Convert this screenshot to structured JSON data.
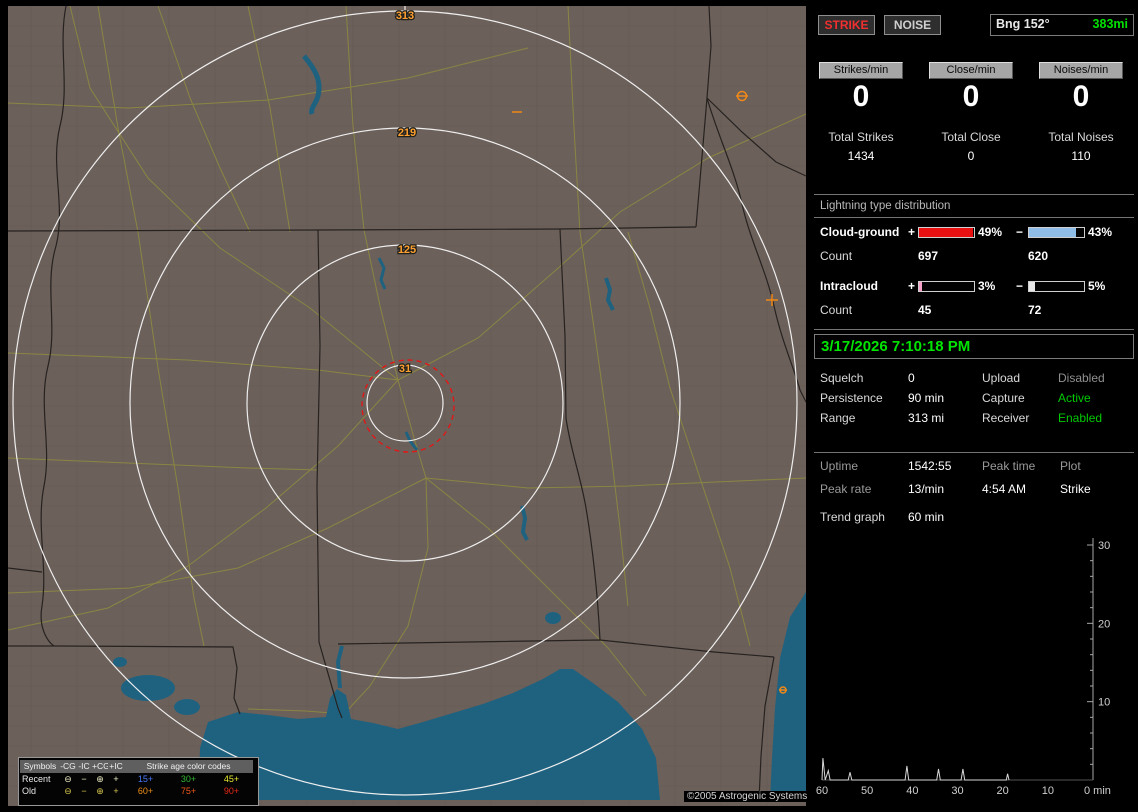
{
  "window": {
    "copyright": "©2005 Astrogenic Systems"
  },
  "map": {
    "range_labels": [
      "313",
      "219",
      "125",
      "31"
    ],
    "legend": {
      "symbols_header": "Symbols",
      "col_headers": [
        "-CG",
        "-IC",
        "+CG",
        "+IC"
      ],
      "age_header": "Strike age color codes",
      "rows": [
        {
          "label": "Recent",
          "symbols": [
            "⊖",
            "−",
            "⊕",
            "+"
          ],
          "symbol_color": "#f0f0c8",
          "ages": [
            "15+",
            "30+",
            "45+"
          ],
          "age_colors": [
            "#4878f8",
            "#30b830",
            "#e8e830"
          ]
        },
        {
          "label": "Old",
          "symbols": [
            "⊖",
            "−",
            "⊕",
            "+"
          ],
          "symbol_color": "#d8c850",
          "ages": [
            "60+",
            "75+",
            "90+"
          ],
          "age_colors": [
            "#f09018",
            "#f05818",
            "#e82818"
          ]
        }
      ]
    }
  },
  "sidebar": {
    "strike_button": "STRIKE",
    "noise_button": "NOISE",
    "strike_color": "#f03030",
    "noise_color": "#cfcfcf",
    "bearing": {
      "label": "Bng 152°",
      "value": "383mi",
      "value_color": "#00e000"
    },
    "rate_chips": [
      {
        "label": "Strikes/min",
        "value": "0"
      },
      {
        "label": "Close/min",
        "value": "0"
      },
      {
        "label": "Noises/min",
        "value": "0"
      }
    ],
    "totals": [
      {
        "label": "Total Strikes",
        "value": "1434"
      },
      {
        "label": "Total Close",
        "value": "0"
      },
      {
        "label": "Total Noises",
        "value": "110"
      }
    ],
    "distribution": {
      "title": "Lightning type distribution",
      "rows": [
        {
          "label": "Cloud-ground",
          "pos_sign": "+",
          "pos_pct": "49%",
          "pos_fill": "98%",
          "pos_color": "#e81010",
          "neg_sign": "−",
          "neg_pct": "43%",
          "neg_fill": "86%",
          "neg_color": "#90bce8",
          "count_label": "Count",
          "pos_count": "697",
          "neg_count": "620"
        },
        {
          "label": "Intracloud",
          "pos_sign": "+",
          "pos_pct": "3%",
          "pos_fill": "6%",
          "pos_color": "#f8a0c8",
          "neg_sign": "−",
          "neg_pct": "5%",
          "neg_fill": "10%",
          "neg_color": "#e8e8e8",
          "count_label": "Count",
          "pos_count": "45",
          "neg_count": "72"
        }
      ]
    },
    "datetime": "3/17/2026 7:10:18 PM",
    "settings": [
      {
        "l1": "Squelch",
        "v1": "0",
        "l2": "Upload",
        "v2": "Disabled",
        "v2_color": "#909090"
      },
      {
        "l1": "Persistence",
        "v1": "90 min",
        "l2": "Capture",
        "v2": "Active",
        "v2_color": "#00cc00"
      },
      {
        "l1": "Range",
        "v1": "313 mi",
        "l2": "Receiver",
        "v2": "Enabled",
        "v2_color": "#00cc00"
      }
    ],
    "info": {
      "uptime_label": "Uptime",
      "uptime": "1542:55",
      "peak_time_label": "Peak time",
      "plot_label": "Plot",
      "peak_rate_label": "Peak rate",
      "peak_rate": "13/min",
      "peak_time": "4:54 AM",
      "plot": "Strike"
    },
    "trend_label": "Trend graph",
    "trend_window": "60 min"
  },
  "chart_data": {
    "type": "line",
    "title": "Trend graph (strikes per minute, last 60 min)",
    "xlabel": "min",
    "ylabel": "",
    "x_ticks": [
      60,
      50,
      40,
      30,
      20,
      10
    ],
    "x_end_label": "0 min",
    "y_ticks": [
      10,
      20,
      30
    ],
    "ylim": [
      0,
      30
    ],
    "xlim_minutes_ago": [
      60,
      0
    ],
    "legend_position": "none",
    "grid": false,
    "series": [
      {
        "name": "strike_rate",
        "points": [
          [
            60,
            0
          ],
          [
            59.8,
            2.8
          ],
          [
            59.3,
            0
          ],
          [
            58.6,
            1.2
          ],
          [
            58.2,
            0
          ],
          [
            54.2,
            0
          ],
          [
            53.8,
            1.0
          ],
          [
            53.4,
            0
          ],
          [
            41.6,
            0
          ],
          [
            41.2,
            1.8
          ],
          [
            40.8,
            0
          ],
          [
            34.6,
            0
          ],
          [
            34.2,
            1.4
          ],
          [
            33.8,
            0
          ],
          [
            29.2,
            0
          ],
          [
            28.8,
            1.4
          ],
          [
            28.4,
            0
          ],
          [
            19.2,
            0
          ],
          [
            18.9,
            0.8
          ],
          [
            18.6,
            0
          ]
        ]
      }
    ]
  }
}
